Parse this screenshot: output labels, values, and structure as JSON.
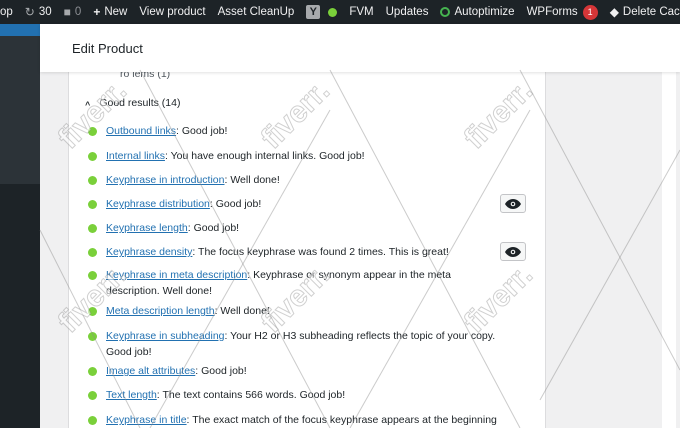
{
  "adminbar": {
    "site_fragment": "op",
    "updates_count": "30",
    "comments_count": "0",
    "new_label": "New",
    "view_product": "View product",
    "asset_cleanup": "Asset CleanUp",
    "yoast_letter": "Y",
    "fvm": "FVM",
    "updates": "Updates",
    "autoptimize": "Autoptimize",
    "wpforms": "WPForms",
    "wpforms_badge": "1",
    "delete_cache": "Delete Cach"
  },
  "header": {
    "title": "Edit Product"
  },
  "seo": {
    "cut_heading": "ro lems (1)",
    "good_results_label": "Good results (14)",
    "items": [
      {
        "link": "Outbound links",
        "text": ": Good job!"
      },
      {
        "link": "Internal links",
        "text": ": You have enough internal links. Good job!"
      },
      {
        "link": "Keyphrase in introduction",
        "text": ": Well done!"
      },
      {
        "link": "Keyphrase distribution",
        "text": ": Good job!"
      },
      {
        "link": "Keyphrase length",
        "text": ": Good job!"
      },
      {
        "link": "Keyphrase density",
        "text": ": The focus keyphrase was found 2 times. This is great!"
      },
      {
        "link": "Keyphrase in meta description",
        "text": ": Keyphrase or synonym appear in the meta description. Well done!"
      },
      {
        "link": "Meta description length",
        "text": ": Well done!"
      },
      {
        "link": "Keyphrase in subheading",
        "text": ": Your H2 or H3 subheading reflects the topic of your copy. Good job!"
      },
      {
        "link": "Image alt attributes",
        "text": ": Good job!"
      },
      {
        "link": "Text length",
        "text": ": The text contains 566 words. Good job!"
      },
      {
        "link": "Keyphrase in title",
        "text": ": The exact match of the focus keyphrase appears at the beginning of"
      }
    ]
  },
  "watermark": "fiverr."
}
